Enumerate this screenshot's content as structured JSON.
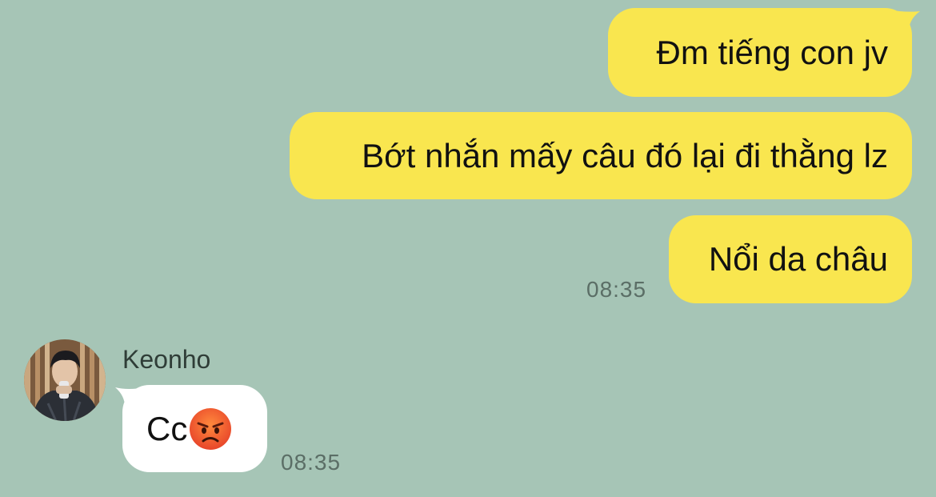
{
  "chat": {
    "background": "#a6c5b6",
    "outgoing_color": "#f9e64f",
    "incoming_color": "#ffffff",
    "outgoing": [
      {
        "text": "Đm tiếng con jv"
      },
      {
        "text": "Bớt nhắn mấy câu đó lại đi thằng lz"
      },
      {
        "text": "Nổi da châu"
      }
    ],
    "outgoing_time": "08:35",
    "incoming": {
      "sender": "Keonho",
      "avatar_icon": "profile-photo",
      "text": "Cc",
      "emoji": "angry-face-emoji",
      "time": "08:35"
    }
  }
}
